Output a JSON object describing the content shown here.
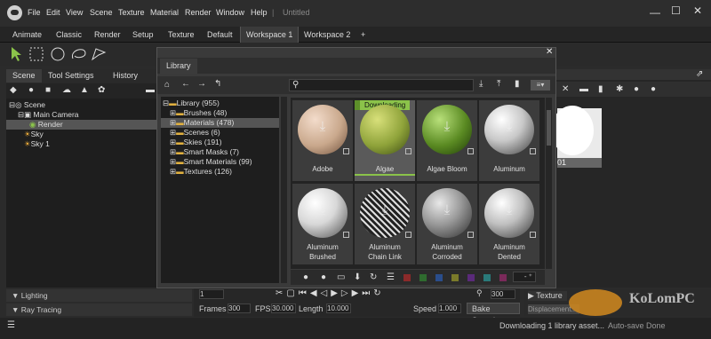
{
  "menu": [
    "File",
    "Edit",
    "View",
    "Scene",
    "Texture",
    "Material",
    "Render",
    "Window",
    "Help"
  ],
  "doc_title": "Untitled",
  "workspaces": [
    "Animate",
    "Classic",
    "Render",
    "Setup",
    "Texture",
    "Default",
    "Workspace 1",
    "Workspace 2",
    "+"
  ],
  "left_tabs": [
    "Scene",
    "Tool Settings",
    "History"
  ],
  "scene_tree": [
    {
      "label": "Scene",
      "indent": 0
    },
    {
      "label": "Main Camera",
      "indent": 1
    },
    {
      "label": "Render",
      "indent": 2,
      "selected": true
    },
    {
      "label": "Sky",
      "indent": 1
    },
    {
      "label": "Sky 1",
      "indent": 1
    }
  ],
  "sections": [
    "Lighting",
    "Ray Tracing"
  ],
  "library": {
    "tab": "Library",
    "tree": [
      {
        "label": "Library (955)",
        "indent": 0
      },
      {
        "label": "Brushes (48)",
        "indent": 1
      },
      {
        "label": "Materials (478)",
        "indent": 1,
        "selected": true
      },
      {
        "label": "Scenes (6)",
        "indent": 1
      },
      {
        "label": "Skies (191)",
        "indent": 1
      },
      {
        "label": "Smart Masks (7)",
        "indent": 1
      },
      {
        "label": "Smart Materials (99)",
        "indent": 1
      },
      {
        "label": "Textures (126)",
        "indent": 1
      }
    ],
    "downloading_badge": "Downloading",
    "materials": [
      {
        "label": "Adobe",
        "color": "#c9a88c",
        "line2": ""
      },
      {
        "label": "Algae",
        "color": "#8fa33a",
        "line2": "",
        "selected": true
      },
      {
        "label": "Algae Bloom",
        "color": "#5a8a22",
        "line2": ""
      },
      {
        "label": "Aluminum",
        "color": "#c8c8c8",
        "line2": ""
      },
      {
        "label": "Aluminum",
        "color": "#d8d8d8",
        "line2": "Brushed"
      },
      {
        "label": "Aluminum",
        "color": "#9a9a9a",
        "line2": "Chain Link"
      },
      {
        "label": "Aluminum",
        "color": "#b5b5b5",
        "line2": "Corroded"
      },
      {
        "label": "Aluminum",
        "color": "#c0c0c0",
        "line2": "Dented"
      }
    ],
    "swatches": [
      "#8b2a2a",
      "#2f6b2f",
      "#2a4d8b",
      "#7a7a2a",
      "#5a2a7a",
      "#2a7a7a",
      "#7a2a5a",
      "#5a5a5a"
    ],
    "zoom_value": "-"
  },
  "timeline": {
    "frame_value": "1",
    "frames_label": "Frames",
    "frames_value": "300",
    "fps_label": "FPS",
    "fps_value": "30.000",
    "length_label": "Length",
    "length_value": "10.000",
    "end_value": "300",
    "speed_label": "Speed",
    "speed_value": "1.000",
    "bake_label": "Bake Speed"
  },
  "right_props": {
    "texture_label": "Texture",
    "displacement_label": "Displacement..."
  },
  "viewport_value": "01",
  "status": {
    "message": "Downloading 1 library asset...",
    "right": "Auto-save Done"
  },
  "watermark": "KoLomPC",
  "colors": {
    "accent_green": "#8bc34a",
    "bg": "#2b2b2b"
  }
}
